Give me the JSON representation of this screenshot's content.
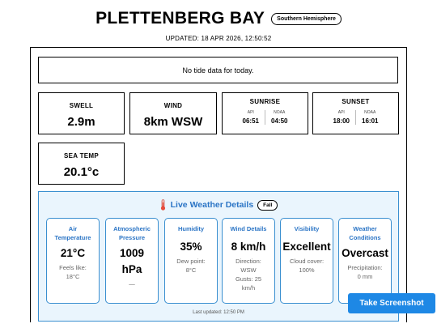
{
  "header": {
    "title": "PLETTENBERG BAY",
    "hemisphere_badge": "Southern Hemisphere",
    "updated": "UPDATED: 18 APR 2026, 12:50:52"
  },
  "tide": {
    "message": "No tide data for today."
  },
  "stats": {
    "swell": {
      "label": "SWELL",
      "value": "2.9m"
    },
    "wind": {
      "label": "WIND",
      "value": "8km WSW"
    },
    "sunrise": {
      "label": "SUNRISE",
      "api_label": "API",
      "api_time": "06:51",
      "noaa_label": "NOAA",
      "noaa_time": "04:50"
    },
    "sunset": {
      "label": "SUNSET",
      "api_label": "API",
      "api_time": "18:00",
      "noaa_label": "NOAA",
      "noaa_time": "16:01"
    },
    "sea_temp": {
      "label": "SEA TEMP",
      "value": "20.1°c"
    }
  },
  "live_weather": {
    "title": "Live Weather Details",
    "season_badge": "Fall",
    "icon": "thermometer-icon",
    "cards": [
      {
        "label_line1": "Air",
        "label_line2": "Temperature",
        "value_line1": "21°C",
        "value_line2": "",
        "sub_line1": "Feels like:",
        "sub_line2": "18°C",
        "sub_line3": "",
        "sub_line4": ""
      },
      {
        "label_line1": "Atmospheric",
        "label_line2": "Pressure",
        "value_line1": "1009",
        "value_line2": "hPa",
        "sub_line1": "—",
        "sub_line2": "",
        "sub_line3": "",
        "sub_line4": ""
      },
      {
        "label_line1": "Humidity",
        "label_line2": "",
        "value_line1": "35%",
        "value_line2": "",
        "sub_line1": "Dew point:",
        "sub_line2": "8°C",
        "sub_line3": "",
        "sub_line4": ""
      },
      {
        "label_line1": "Wind Details",
        "label_line2": "",
        "value_line1": "8 km/h",
        "value_line2": "",
        "sub_line1": "Direction:",
        "sub_line2": "WSW",
        "sub_line3": "Gusts: 25",
        "sub_line4": "km/h"
      },
      {
        "label_line1": "Visibility",
        "label_line2": "",
        "value_line1": "Excellent",
        "value_line2": "",
        "sub_line1": "Cloud cover:",
        "sub_line2": "100%",
        "sub_line3": "",
        "sub_line4": ""
      },
      {
        "label_line1": "Weather",
        "label_line2": "Conditions",
        "value_line1": "Overcast",
        "value_line2": "",
        "sub_line1": "Precipitation:",
        "sub_line2": "0 mm",
        "sub_line3": "",
        "sub_line4": ""
      }
    ],
    "last_updated": "Last updated: 12:50 PM"
  },
  "actions": {
    "screenshot_label": "Take Screenshot"
  },
  "colors": {
    "accent": "#2a74c5",
    "panel_bg": "#eaf5fd",
    "panel_border": "#3a8fd0",
    "button_bg": "#1e88e5",
    "thermometer": "#e74c3c"
  }
}
